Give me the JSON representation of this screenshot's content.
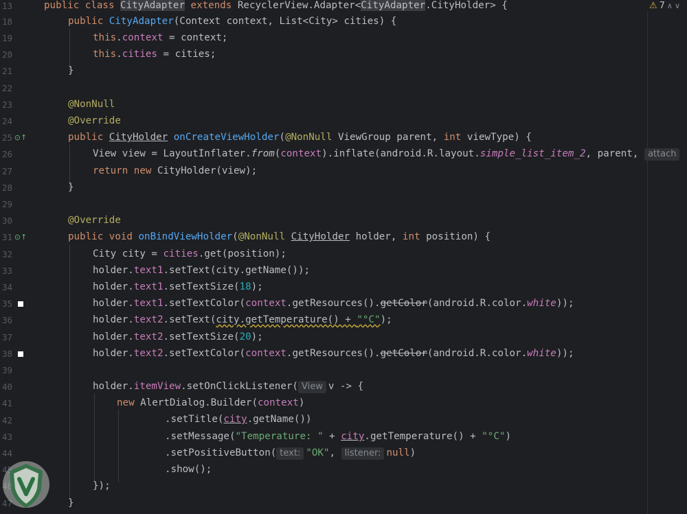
{
  "gutter": {
    "line_numbers": [
      "13",
      "18",
      "19",
      "20",
      "21",
      "22",
      "23",
      "24",
      "25",
      "26",
      "27",
      "28",
      "29",
      "30",
      "31",
      "32",
      "33",
      "34",
      "35",
      "36",
      "37",
      "38",
      "39",
      "40",
      "41",
      "42",
      "43",
      "44",
      "45",
      "46",
      "47"
    ]
  },
  "status": {
    "warning_count": "7"
  },
  "hints": {
    "view_type": "View",
    "text_param": "text:",
    "listener_param": "listener:",
    "attach": "attach"
  },
  "code": {
    "l13": {
      "a": "public class ",
      "b": "CityAdapter",
      "c": " extends ",
      "d": "RecyclerView.Adapter<",
      "e": "CityAdapter",
      "f": ".CityHolder> {"
    },
    "l18": {
      "a": "public ",
      "b": "CityAdapter",
      "c": "(Context context, List<City> cities) {"
    },
    "l19": {
      "a": "this",
      "b": ".",
      "c": "context",
      "d": " = context;"
    },
    "l20": {
      "a": "this",
      "b": ".",
      "c": "cities",
      "d": " = cities;"
    },
    "l21": {
      "a": "}"
    },
    "l23": {
      "a": "@NonNull"
    },
    "l24": {
      "a": "@Override"
    },
    "l25": {
      "a": "public ",
      "b": "CityHolder",
      "c": " ",
      "d": "onCreateViewHolder",
      "e": "(",
      "f": "@NonNull",
      "g": " ViewGroup parent, ",
      "h": "int",
      "i": " viewType) {"
    },
    "l26": {
      "a": "View view = LayoutInflater.",
      "b": "from",
      "c": "(",
      "d": "context",
      "e": ").inflate(android.R.layout.",
      "f": "simple_list_item_2",
      "g": ", parent, "
    },
    "l27": {
      "a": "return new ",
      "b": "CityHolder(view);"
    },
    "l28": {
      "a": "}"
    },
    "l30": {
      "a": "@Override"
    },
    "l31": {
      "a": "public void ",
      "b": "onBindViewHolder",
      "c": "(",
      "d": "@NonNull",
      "e": " ",
      "f": "CityHolder",
      "g": " holder, ",
      "h": "int",
      "i": " position) {"
    },
    "l32": {
      "a": "City city = ",
      "b": "cities",
      "c": ".get(position);"
    },
    "l33": {
      "a": "holder.",
      "b": "text1",
      "c": ".setText(city.getName());"
    },
    "l34": {
      "a": "holder.",
      "b": "text1",
      "c": ".setTextSize(",
      "d": "18",
      "e": ");"
    },
    "l35": {
      "a": "holder.",
      "b": "text1",
      "c": ".setTextColor(",
      "d": "context",
      "e": ".getResources().",
      "f": "getColor",
      "g": "(android.R.color.",
      "h": "white",
      "i": "));"
    },
    "l36": {
      "a": "holder.",
      "b": "text2",
      "c": ".setText(",
      "d": "city.getTemperature() + ",
      "e": "\"°C\"",
      "f": ");"
    },
    "l37": {
      "a": "holder.",
      "b": "text2",
      "c": ".setTextSize(",
      "d": "20",
      "e": ");"
    },
    "l38": {
      "a": "holder.",
      "b": "text2",
      "c": ".setTextColor(",
      "d": "context",
      "e": ".getResources().",
      "f": "getColor",
      "g": "(android.R.color.",
      "h": "white",
      "i": "));"
    },
    "l40": {
      "a": "holder.",
      "b": "itemView",
      "c": ".setOnClickListener(",
      "d": "v -> {"
    },
    "l41": {
      "a": "new ",
      "b": "AlertDialog.Builder(",
      "c": "context",
      "d": ")"
    },
    "l42": {
      "a": ".setTitle(",
      "b": "city",
      "c": ".getName())"
    },
    "l43": {
      "a": ".setMessage(",
      "b": "\"Temperature: \"",
      "c": " + ",
      "d": "city",
      "e": ".getTemperature() + ",
      "f": "\"°C\"",
      "g": ")"
    },
    "l44": {
      "a": ".setPositiveButton(",
      "b": "\"OK\"",
      "c": ", ",
      "d": "null",
      "e": ")"
    },
    "l45": {
      "a": ".show();"
    },
    "l46": {
      "a": "});"
    },
    "l47": {
      "a": "}"
    }
  },
  "colors": {
    "background": "#1e1f22",
    "keyword": "#cf8e6d",
    "function": "#56a8f5",
    "field": "#c77dbb",
    "annotation": "#b3ae60",
    "string": "#6aab73",
    "number": "#2aacb8",
    "text": "#bcbec4"
  }
}
